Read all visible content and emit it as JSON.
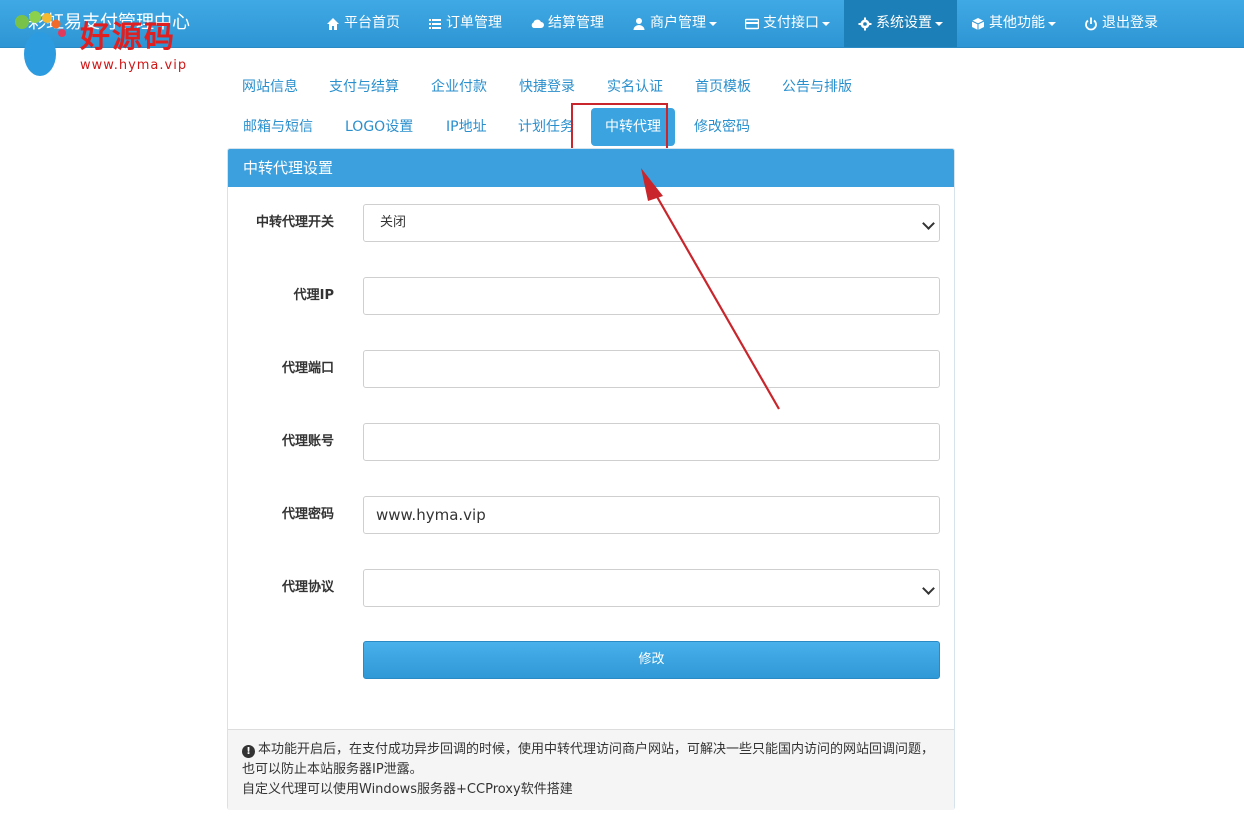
{
  "app": {
    "title": "彩虹易支付管理中心"
  },
  "watermark": {
    "brand": "好源码",
    "url": "www.hyma.vip"
  },
  "nav": {
    "items": [
      {
        "label": "平台首页",
        "icon": "home-icon",
        "dropdown": false,
        "active": false
      },
      {
        "label": "订单管理",
        "icon": "list-icon",
        "dropdown": false,
        "active": false
      },
      {
        "label": "结算管理",
        "icon": "cloud-icon",
        "dropdown": false,
        "active": false
      },
      {
        "label": "商户管理",
        "icon": "user-icon",
        "dropdown": true,
        "active": false
      },
      {
        "label": "支付接口",
        "icon": "credit-card-icon",
        "dropdown": true,
        "active": false
      },
      {
        "label": "系统设置",
        "icon": "gear-icon",
        "dropdown": true,
        "active": true
      },
      {
        "label": "其他功能",
        "icon": "cube-icon",
        "dropdown": true,
        "active": false
      },
      {
        "label": "退出登录",
        "icon": "power-icon",
        "dropdown": false,
        "active": false
      }
    ]
  },
  "tabs": [
    {
      "label": "网站信息"
    },
    {
      "label": "支付与结算"
    },
    {
      "label": "企业付款"
    },
    {
      "label": "快捷登录"
    },
    {
      "label": "实名认证"
    },
    {
      "label": "首页模板"
    },
    {
      "label": "公告与排版"
    },
    {
      "label": "邮箱与短信"
    },
    {
      "label": "LOGO设置"
    },
    {
      "label": "IP地址"
    },
    {
      "label": "计划任务"
    },
    {
      "label": "中转代理",
      "active": true
    },
    {
      "label": "修改密码"
    }
  ],
  "panel": {
    "title": "中转代理设置",
    "fields": {
      "switch": {
        "label": "中转代理开关",
        "value": "关闭"
      },
      "ip": {
        "label": "代理IP",
        "value": ""
      },
      "port": {
        "label": "代理端口",
        "value": ""
      },
      "account": {
        "label": "代理账号",
        "value": ""
      },
      "password": {
        "label": "代理密码",
        "value": "www.hyma.vip"
      },
      "protocol": {
        "label": "代理协议",
        "value": ""
      }
    },
    "submit_label": "修改",
    "note_line1": "本功能开启后，在支付成功异步回调的时候，使用中转代理访问商户网站，可解决一些只能国内访问的网站回调问题，也可以防止本站服务器IP泄露。",
    "note_line2": "自定义代理可以使用Windows服务器+CCProxy软件搭建"
  },
  "colors": {
    "primary": "#3ba0dd",
    "annotation": "#c8262c"
  }
}
